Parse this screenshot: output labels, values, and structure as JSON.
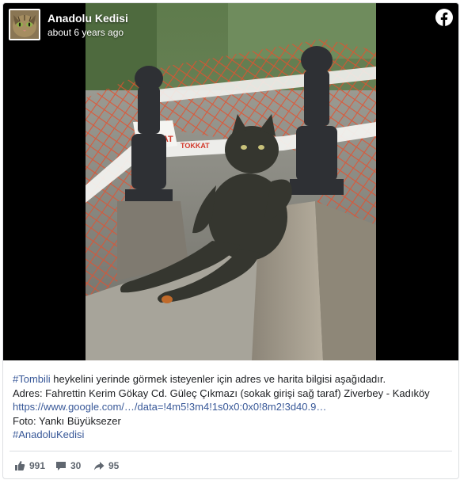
{
  "post": {
    "page_name": "Anadolu Kedisi",
    "timestamp": "about 6 years ago",
    "image": {
      "tape_text": "DİKKAT",
      "tape_text_2": "TOKKAT"
    },
    "text": {
      "hashtag_tombili": "#Tombili",
      "line1_rest": " heykelini yerinde görmek isteyenler için adres ve harita bilgisi aşağıdadır.",
      "line2": "Adres: Fahrettin Kerim Gökay Cd. Güleç Çıkmazı (sokak girişi sağ taraf) Ziverbey - Kadıköy",
      "map_link": "https://www.google.com/…/data=!4m5!3m4!1s0x0:0x0!8m2!3d40.9…",
      "photo_credit": "Foto: Yankı Büyüksezer",
      "hashtag_anadolukedisi": "#AnadoluKedisi"
    },
    "stats": {
      "likes": "991",
      "comments": "30",
      "shares": "95"
    }
  },
  "colors": {
    "link": "#385898",
    "facebook_icon": "#ffffff",
    "stat_text": "#606770"
  },
  "icons": {
    "facebook": "facebook-logo-icon",
    "like": "thumbs-up-icon",
    "comment": "comment-bubble-icon",
    "share": "share-arrow-icon"
  }
}
